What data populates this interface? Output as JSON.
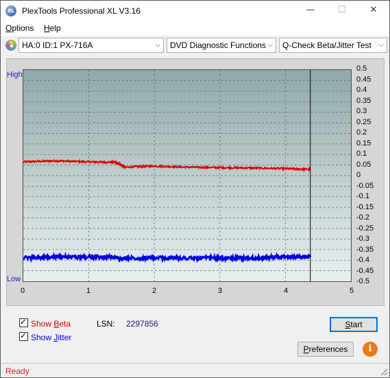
{
  "window": {
    "title": "PlexTools Professional XL V3.16",
    "app_icon_text": "XL"
  },
  "titlebar_buttons": {
    "minimize": "—",
    "maximize": "☐",
    "close": "✕"
  },
  "menu": [
    {
      "label_underline": "O",
      "label_rest": "ptions"
    },
    {
      "label_underline": "H",
      "label_rest": "elp"
    }
  ],
  "toolbar": {
    "drive": "HA:0 ID:1  PX-716A",
    "function": "DVD Diagnostic Functions",
    "test": "Q-Check Beta/Jitter Test"
  },
  "chart_labels": {
    "high": "High",
    "low": "Low"
  },
  "chart_data": {
    "type": "line",
    "x_ticks": [
      "0",
      "1",
      "2",
      "3",
      "4",
      "5"
    ],
    "y_right_ticks": [
      "0.5",
      "0.45",
      "0.4",
      "0.35",
      "0.3",
      "0.25",
      "0.2",
      "0.15",
      "0.1",
      "0.05",
      "0",
      "-0.05",
      "-0.1",
      "-0.15",
      "-0.2",
      "-0.25",
      "-0.3",
      "-0.35",
      "-0.4",
      "-0.45",
      "-0.5"
    ],
    "xlim": [
      0,
      5
    ],
    "ylim": [
      -0.5,
      0.5
    ],
    "end_marker_x": 4.38,
    "series": [
      {
        "color": "#e00000",
        "x": [
          0,
          0.5,
          1.0,
          1.4,
          1.5,
          1.55,
          2.0,
          2.5,
          3.0,
          3.5,
          4.0,
          4.38
        ],
        "y": [
          0.065,
          0.07,
          0.065,
          0.063,
          0.05,
          0.04,
          0.045,
          0.04,
          0.038,
          0.036,
          0.033,
          0.03
        ]
      },
      {
        "color": "#0000e0",
        "x": [
          0,
          0.5,
          1.0,
          1.4,
          1.5,
          1.55,
          2.0,
          2.5,
          3.0,
          3.5,
          4.0,
          4.38
        ],
        "y": [
          -0.39,
          -0.385,
          -0.385,
          -0.385,
          -0.395,
          -0.39,
          -0.39,
          -0.39,
          -0.39,
          -0.39,
          -0.385,
          -0.385
        ]
      }
    ],
    "grid": true
  },
  "controls": {
    "show_beta_pre": "Show ",
    "show_beta_ul": "B",
    "show_beta_post": "eta",
    "show_jitter_pre": "Show ",
    "show_jitter_ul": "J",
    "show_jitter_post": "itter",
    "lsn_label": "LSN:",
    "lsn_value": "2297856",
    "start_ul": "S",
    "start_rest": "tart",
    "preferences_pre": "",
    "preferences_ul": "P",
    "preferences_rest": "references",
    "info_icon_text": "i"
  },
  "colors": {
    "beta": "#e00000",
    "jitter": "#0000e0",
    "status": "#e02020"
  },
  "status": {
    "text": "Ready"
  }
}
